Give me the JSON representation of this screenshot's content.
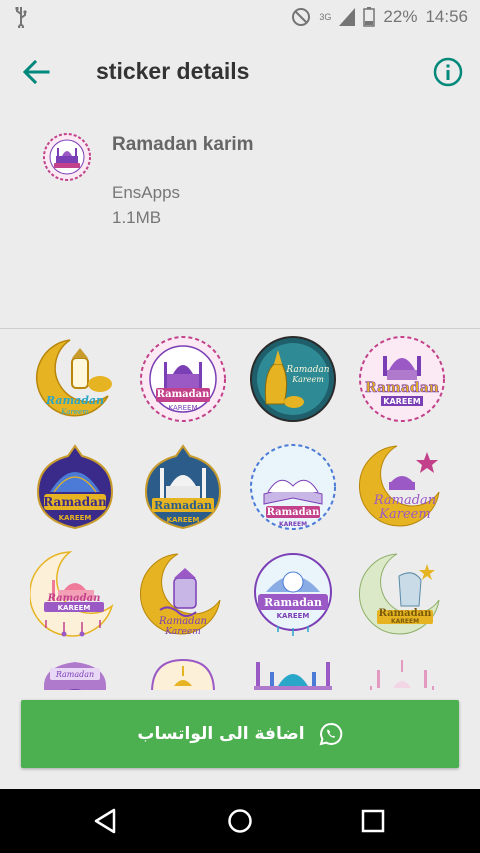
{
  "status_bar": {
    "network": "3G",
    "battery": "22%",
    "time": "14:56"
  },
  "app_bar": {
    "title": "sticker details"
  },
  "pack": {
    "name": "Ramadan karim",
    "publisher": "EnsApps",
    "size": "1.1MB"
  },
  "stickers": [
    {
      "caption1": "Ramadan",
      "caption2": "Kareem"
    },
    {
      "caption1": "Ramadan",
      "caption2": "KAREEM"
    },
    {
      "caption1": "Ramadan",
      "caption2": "Kareem"
    },
    {
      "caption1": "Ramadan",
      "caption2": "KAREEM"
    },
    {
      "caption1": "Ramadan",
      "caption2": "KAREEM"
    },
    {
      "caption1": "Ramadan",
      "caption2": "KAREEM"
    },
    {
      "caption1": "Ramadan",
      "caption2": "KAREEM"
    },
    {
      "caption1": "Ramadan",
      "caption2": "Kareem"
    },
    {
      "caption1": "Ramadan",
      "caption2": "KAREEM"
    },
    {
      "caption1": "Ramadan",
      "caption2": "Kareem"
    },
    {
      "caption1": "Ramadan",
      "caption2": "KAREEM"
    },
    {
      "caption1": "Ramadan",
      "caption2": "KAREEM"
    },
    {
      "caption1": "Ramadan",
      "caption2": ""
    },
    {
      "caption1": "",
      "caption2": ""
    },
    {
      "caption1": "",
      "caption2": ""
    },
    {
      "caption1": "",
      "caption2": ""
    }
  ],
  "add_button": {
    "label": "اضافة الى الواتساب"
  },
  "colors": {
    "accent": "#00897b",
    "button": "#4caf50",
    "gold": "#e6b422",
    "purple": "#7b3fb5",
    "magenta": "#c2418a"
  }
}
